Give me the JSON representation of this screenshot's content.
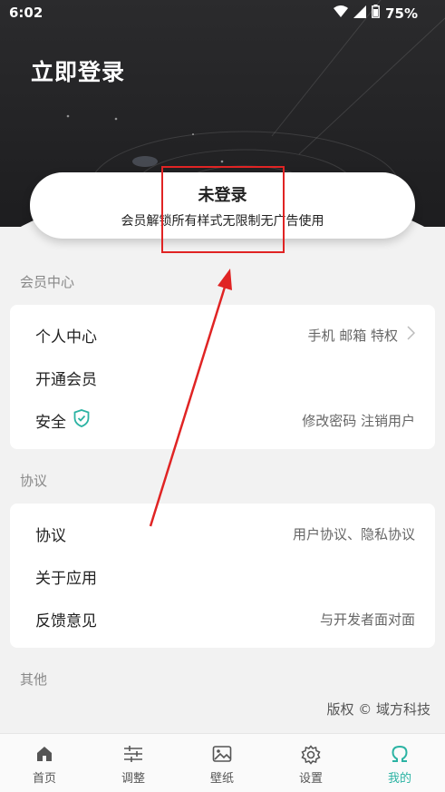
{
  "status_bar": {
    "time": "6:02",
    "battery": "75%"
  },
  "header": {
    "title": "立即登录"
  },
  "profile": {
    "name": "未登录",
    "subtitle": "会员解锁所有样式无限制无广告使用"
  },
  "sections": {
    "member": {
      "title": "会员中心",
      "items": [
        {
          "label": "个人中心",
          "right": "手机 邮箱 特权"
        },
        {
          "label": "开通会员",
          "right": ""
        },
        {
          "label": "安全",
          "right": "修改密码  注销用户"
        }
      ]
    },
    "protocol": {
      "title": "协议",
      "items": [
        {
          "label": "协议",
          "right": "用户协议、隐私协议"
        },
        {
          "label": "关于应用",
          "right": ""
        },
        {
          "label": "反馈意见",
          "right": "与开发者面对面"
        }
      ]
    },
    "other": {
      "title": "其他"
    }
  },
  "copyright": "版权 © 域方科技",
  "tabs": [
    {
      "label": "首页",
      "icon": "home-icon"
    },
    {
      "label": "调整",
      "icon": "sliders-icon"
    },
    {
      "label": "壁纸",
      "icon": "image-icon"
    },
    {
      "label": "设置",
      "icon": "gear-icon"
    },
    {
      "label": "我的",
      "icon": "omega-icon",
      "active": true
    }
  ],
  "colors": {
    "accent": "#2bb3a3",
    "annotation": "#e02424",
    "header_bg": "#232325"
  }
}
